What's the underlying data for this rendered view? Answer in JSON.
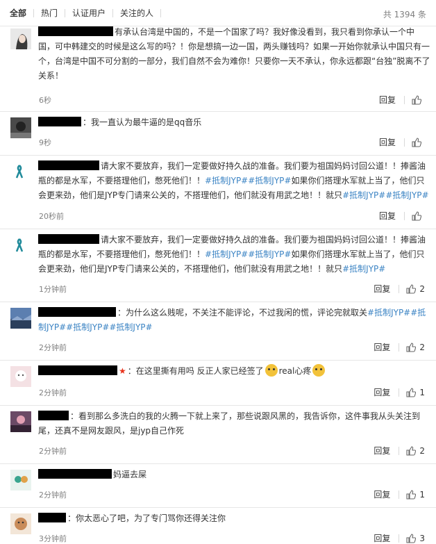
{
  "tabs": [
    "全部",
    "热门",
    "认证用户",
    "关注的人"
  ],
  "total": "共 1394 条",
  "reply_label": "回复",
  "comments": [
    {
      "text": "有承认台湾是中国的，不是一个国家了吗？我好像没看到，我只看到你承认一个中国，可中韩建交的时候是这么写的吗？！你是想搞一边一国，两头赚钱吗？如果一开始你就承认中国只有一个，台湾是中国不可分割的一部分，我们自然不会为难你！只要你一天不承认，你永远都跟“台独”脱离不了关系！",
      "time": "6秒",
      "likes": ""
    },
    {
      "text": "：我一直认为最牛逼的是qq音乐",
      "time": "9秒",
      "likes": ""
    },
    {
      "text_a": "请大家不要放弃，我们一定要做好持久战的准备。我们要为祖国妈妈讨回公道！！捧酱油瓶的都是水军，不要搭理他们，憋死他们！！",
      "tag_1": "#抵制JYP#",
      "tag_2": "#抵制JYP#",
      "text_b": "如果你们搭理水军就上当了，他们只会更来劲，他们是JYP专门请来公关的，不搭理他们，他们就没有用武之地！！就只",
      "tag_3": "#抵制JYP##抵制JYP#",
      "time": "20秒前",
      "likes": ""
    },
    {
      "text_a": "请大家不要放弃，我们一定要做好持久战的准备。我们要为祖国妈妈讨回公道！！捧酱油瓶的都是水军，不要搭理他们，憋死他们！！",
      "tag_1": "#抵制JYP#",
      "tag_2": "#抵制JYP#",
      "text_b": "如果你们搭理水军就上当了，他们只会更来劲，他们是JYP专门请来公关的，不搭理他们，他们就没有用武之地！！就只",
      "tag_3": "#抵制JYP#",
      "time": "1分钟前",
      "likes": "2"
    },
    {
      "text": "：为什么这么贱呢，不关注不能评论，不过我闲的慌，评论完就取关",
      "tag_1": "#抵制JYP##抵制JYP##抵制JYP##抵制JYP#",
      "time": "2分钟前",
      "likes": "2"
    },
    {
      "text": "：在这里撕有用吗 反正人家已经签了",
      "text_b": "real心疼",
      "time": "2分钟前",
      "likes": "1"
    },
    {
      "text": "：看到那么多洗白的我的火腾一下就上来了，那些说跟风黑的，我告诉你，这件事我从头关注到尾，还真不是网友跟风，是jyp自己作死",
      "time": "2分钟前",
      "likes": "2"
    },
    {
      "text": "妈逼去屎",
      "time": "2分钟前",
      "likes": "1"
    },
    {
      "text": "：你太恶心了吧，为了专门骂你还得关注你",
      "time": "3分钟前",
      "likes": "3"
    }
  ],
  "colors": {
    "tag": "#3c84c4",
    "meta": "#808080",
    "divider": "#e6e6e6"
  }
}
